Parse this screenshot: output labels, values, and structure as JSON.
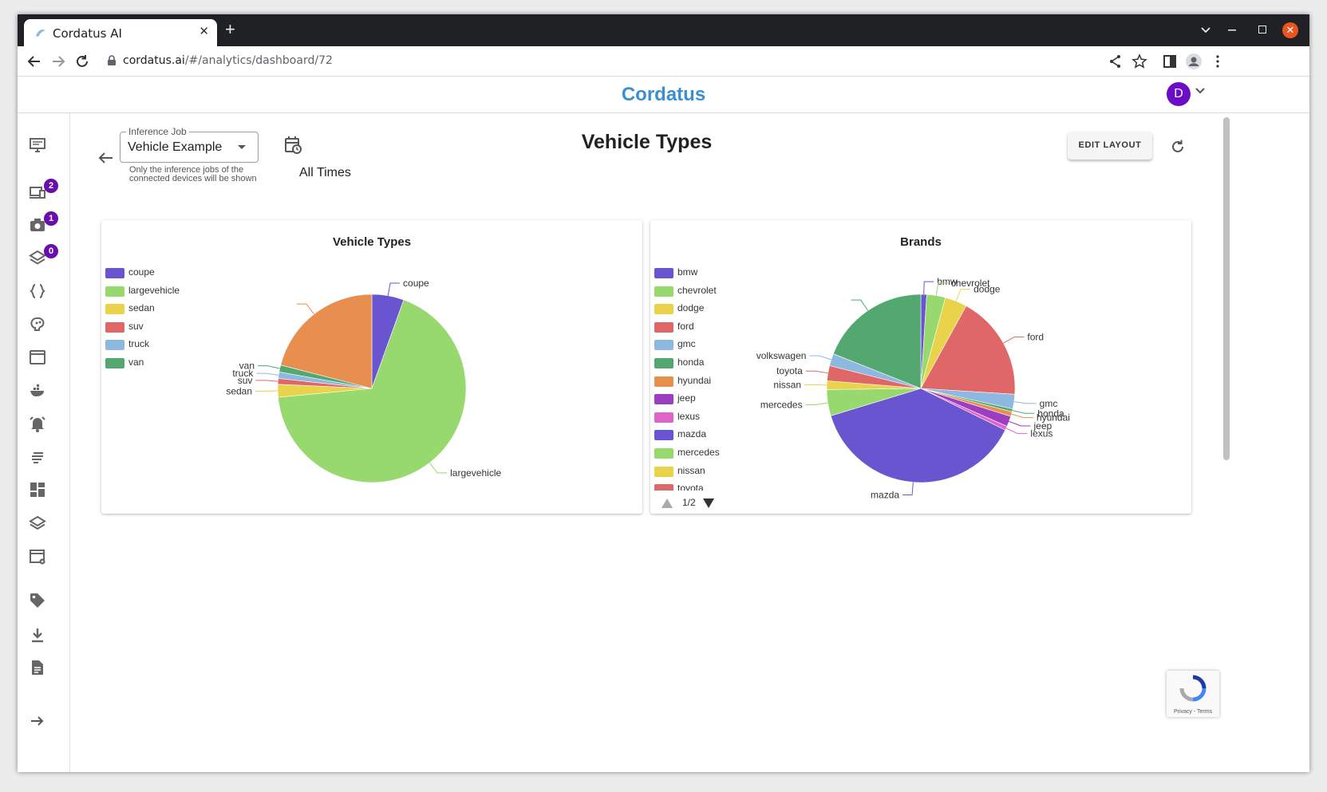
{
  "browser": {
    "tab_title": "Cordatus AI",
    "tab_close": "✕",
    "new_tab": "+",
    "url_host": "cordatus.ai",
    "url_path": "/#/analytics/dashboard/72"
  },
  "app": {
    "brand": "Cordatus",
    "user_initial": "D"
  },
  "sidebar": {
    "badges": {
      "devices": "2",
      "cameras": "1",
      "layers": "0"
    }
  },
  "toolbar": {
    "job_label": "Inference Job",
    "job_value": "Vehicle Example",
    "job_helper": "Only the inference jobs of the connected devices will be shown",
    "time_range": "All Times",
    "dashboard_title": "Vehicle Types",
    "edit_layout": "EDIT LAYOUT"
  },
  "cards": {
    "vehicle_title": "Vehicle Types",
    "brands_title": "Brands",
    "brands_pager": "1/2"
  },
  "recaptcha": {
    "text": "Privacy - Terms"
  },
  "colors": {
    "palette": [
      "#6a55d0",
      "#97d86f",
      "#e8d34b",
      "#e06767",
      "#8eb8e0",
      "#52a86e",
      "#e88f4f",
      "#9b3fc0",
      "#e064c8"
    ]
  },
  "chart_data": [
    {
      "type": "pie",
      "title": "Vehicle Types",
      "legend": "left",
      "categories": [
        "coupe",
        "largevehicle",
        "sedan",
        "suv",
        "truck",
        "van"
      ],
      "values": [
        5.5,
        68.0,
        2.2,
        1.0,
        1.1,
        1.2
      ],
      "unlabeled_slices": [
        {
          "color": "#e88f4f",
          "value": 21.0
        }
      ]
    },
    {
      "type": "pie",
      "title": "Brands",
      "legend": "left",
      "categories": [
        "bmw",
        "chevrolet",
        "dodge",
        "ford",
        "gmc",
        "honda",
        "hyundai",
        "jeep",
        "lexus",
        "mazda",
        "mercedes",
        "nissan",
        "toyota",
        "volkswagen"
      ],
      "values": [
        1.0,
        3.2,
        3.8,
        18.0,
        2.5,
        0.5,
        0.8,
        1.8,
        0.7,
        38.0,
        4.5,
        1.5,
        2.6,
        2.1
      ],
      "unlabeled_slices": [
        {
          "color": "#52a86e",
          "value": 19.0
        }
      ]
    }
  ]
}
